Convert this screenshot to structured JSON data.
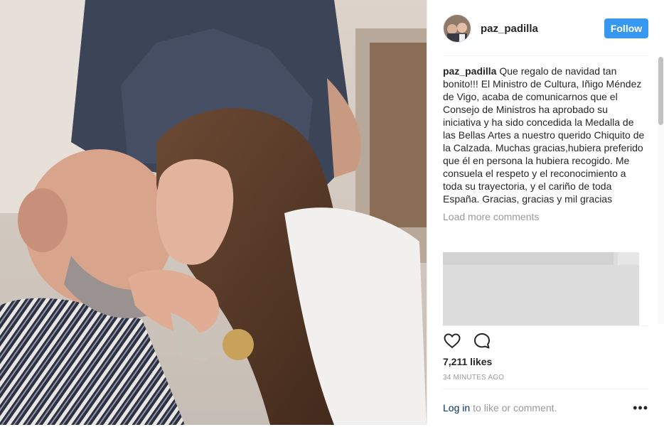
{
  "post": {
    "image_alt": "Photo of a woman kissing an older man"
  },
  "header": {
    "username": "paz_padilla",
    "follow_label": "Follow"
  },
  "caption": {
    "username": "paz_padilla",
    "text": "Que regalo de navidad tan bonito!!! El Ministro de Cultura, Iñigo Méndez de Vigo, acaba de comunicarnos que el Consejo de Ministros ha aprobado su iniciativa y ha sido concedida la Medalla de las Bellas Artes a nuestro querido Chiquito de la Calzada. Muchas gracias,hubiera preferido que él en persona la hubiera recogido. Me consuela el respeto y el reconocimiento a toda su trayectoria, y el cariño de toda España. Gracias, gracias y mil gracias"
  },
  "comments": {
    "load_more_label": "Load more comments"
  },
  "actions": {
    "like_icon": "heart-icon",
    "comment_icon": "comment-icon"
  },
  "stats": {
    "likes": "7,211 likes",
    "time_ago": "34 MINUTES AGO"
  },
  "footer": {
    "login_label": "Log in",
    "login_suffix": "to like or comment.",
    "more_label": "•••"
  },
  "colors": {
    "follow_button": "#3897f0",
    "link": "#003569",
    "muted": "#999999",
    "text": "#262626"
  }
}
